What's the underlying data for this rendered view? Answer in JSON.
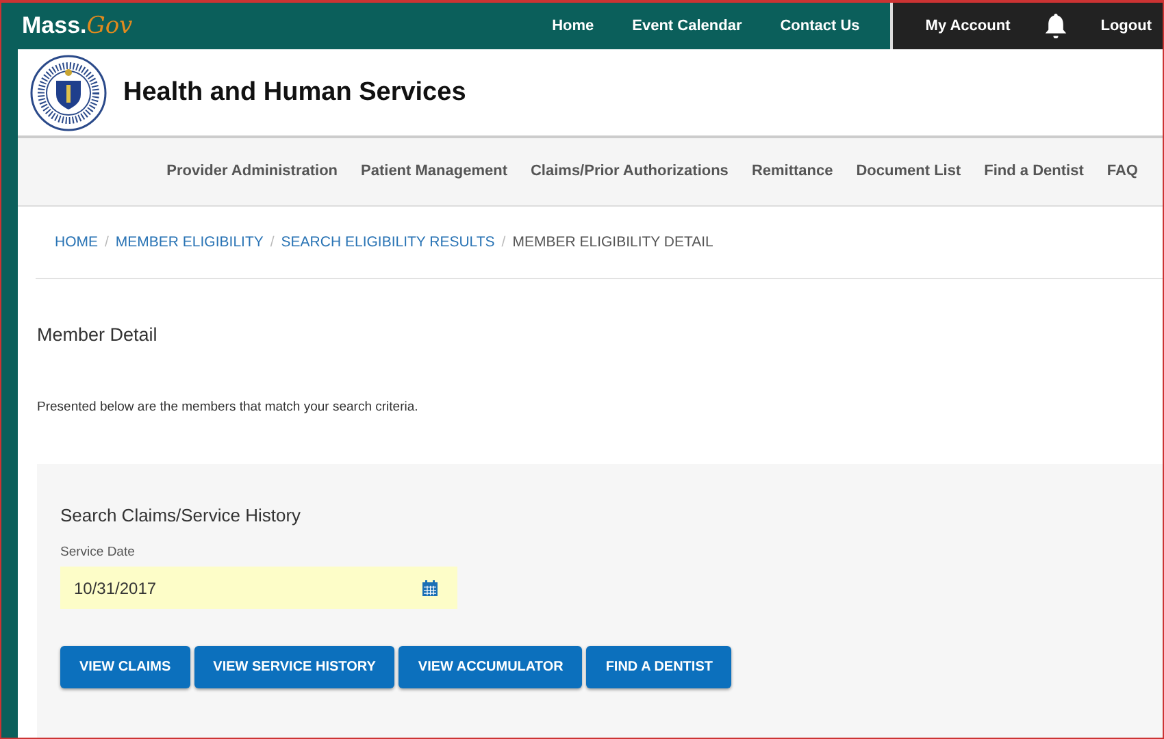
{
  "top_bar": {
    "logo": {
      "main": "Mass.",
      "accent": "Gov"
    },
    "links": [
      "Home",
      "Event Calendar",
      "Contact Us"
    ],
    "account": {
      "label": "My Account",
      "logout": "Logout"
    }
  },
  "header": {
    "title": "Health and Human Services"
  },
  "nav": [
    "Provider Administration",
    "Patient Management",
    "Claims/Prior Authorizations",
    "Remittance",
    "Document List",
    "Find a Dentist",
    "FAQ"
  ],
  "breadcrumb": {
    "separator": "/",
    "items": [
      {
        "label": "HOME",
        "current": false
      },
      {
        "label": "MEMBER ELIGIBILITY",
        "current": false
      },
      {
        "label": "SEARCH ELIGIBILITY RESULTS",
        "current": false
      },
      {
        "label": "MEMBER ELIGIBILITY DETAIL",
        "current": true
      }
    ]
  },
  "page": {
    "heading": "Member Detail",
    "intro": "Presented below are the members that match your search criteria."
  },
  "search": {
    "title": "Search Claims/Service History",
    "field_label": "Service Date",
    "value": "10/31/2017",
    "buttons": [
      "VIEW CLAIMS",
      "VIEW SERVICE HISTORY",
      "VIEW ACCUMULATOR",
      "FIND A DENTIST"
    ]
  }
}
